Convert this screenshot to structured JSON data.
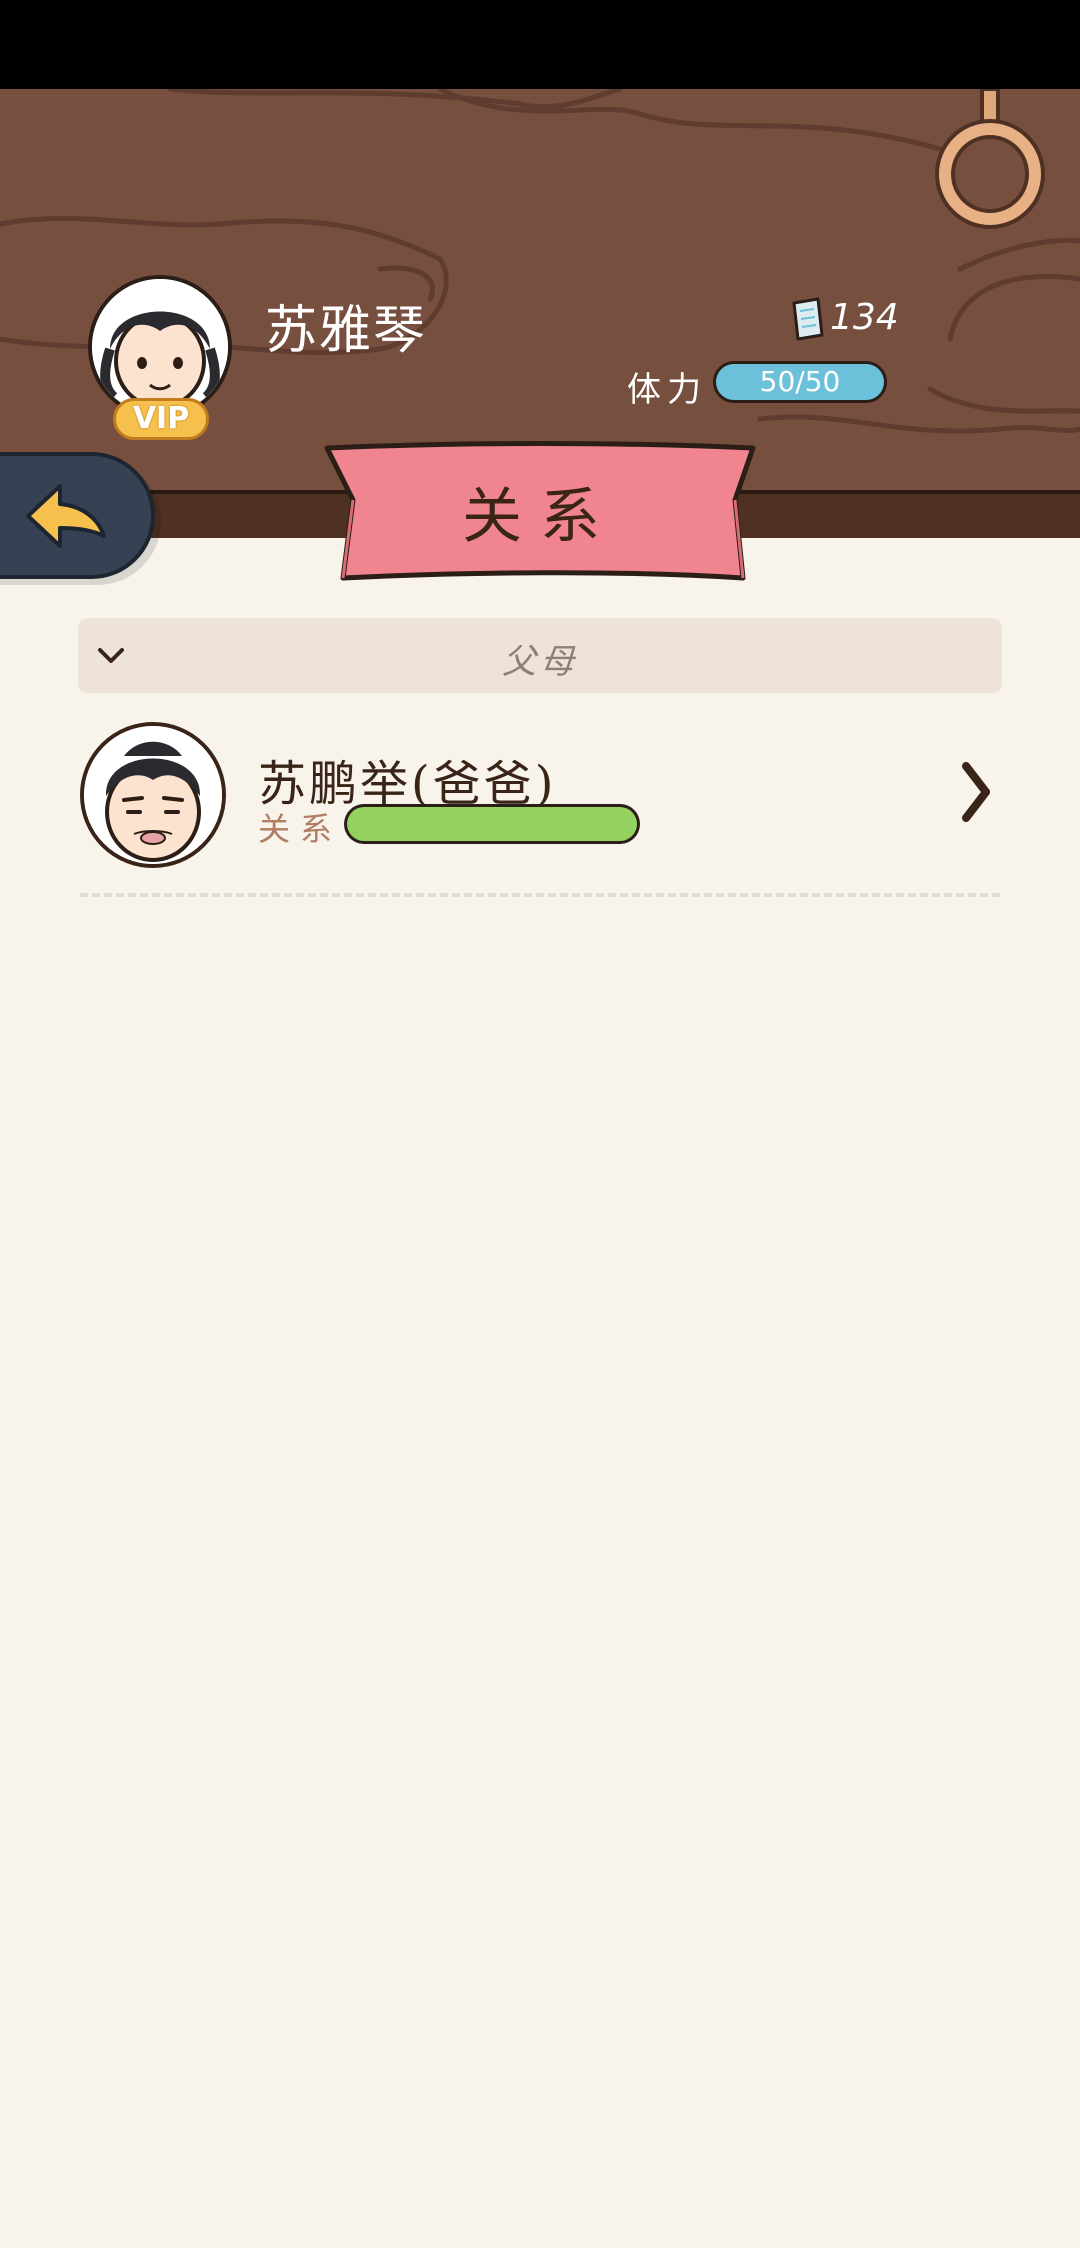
{
  "player": {
    "name": "苏雅琴",
    "vip_label": "VIP",
    "coin_count": "134",
    "stamina_label": "体力",
    "stamina_value": "50/50"
  },
  "page": {
    "title": "关系"
  },
  "section": {
    "title": "父母"
  },
  "relations": [
    {
      "name": "苏鹏举(爸爸)",
      "relation_label": "关系",
      "relation_level": 1.0
    }
  ],
  "colors": {
    "wood": "#764f3f",
    "banner": "#f1858f",
    "stamina": "#6cc1da",
    "relation_bar": "#94d15e",
    "back_button": "#364254",
    "back_arrow": "#f6c04d"
  },
  "icons": {
    "back": "back-arrow-icon",
    "coin": "ticket-icon",
    "collapse": "chevron-down-icon",
    "open": "chevron-right-icon",
    "hang_ring": "ring-icon"
  }
}
